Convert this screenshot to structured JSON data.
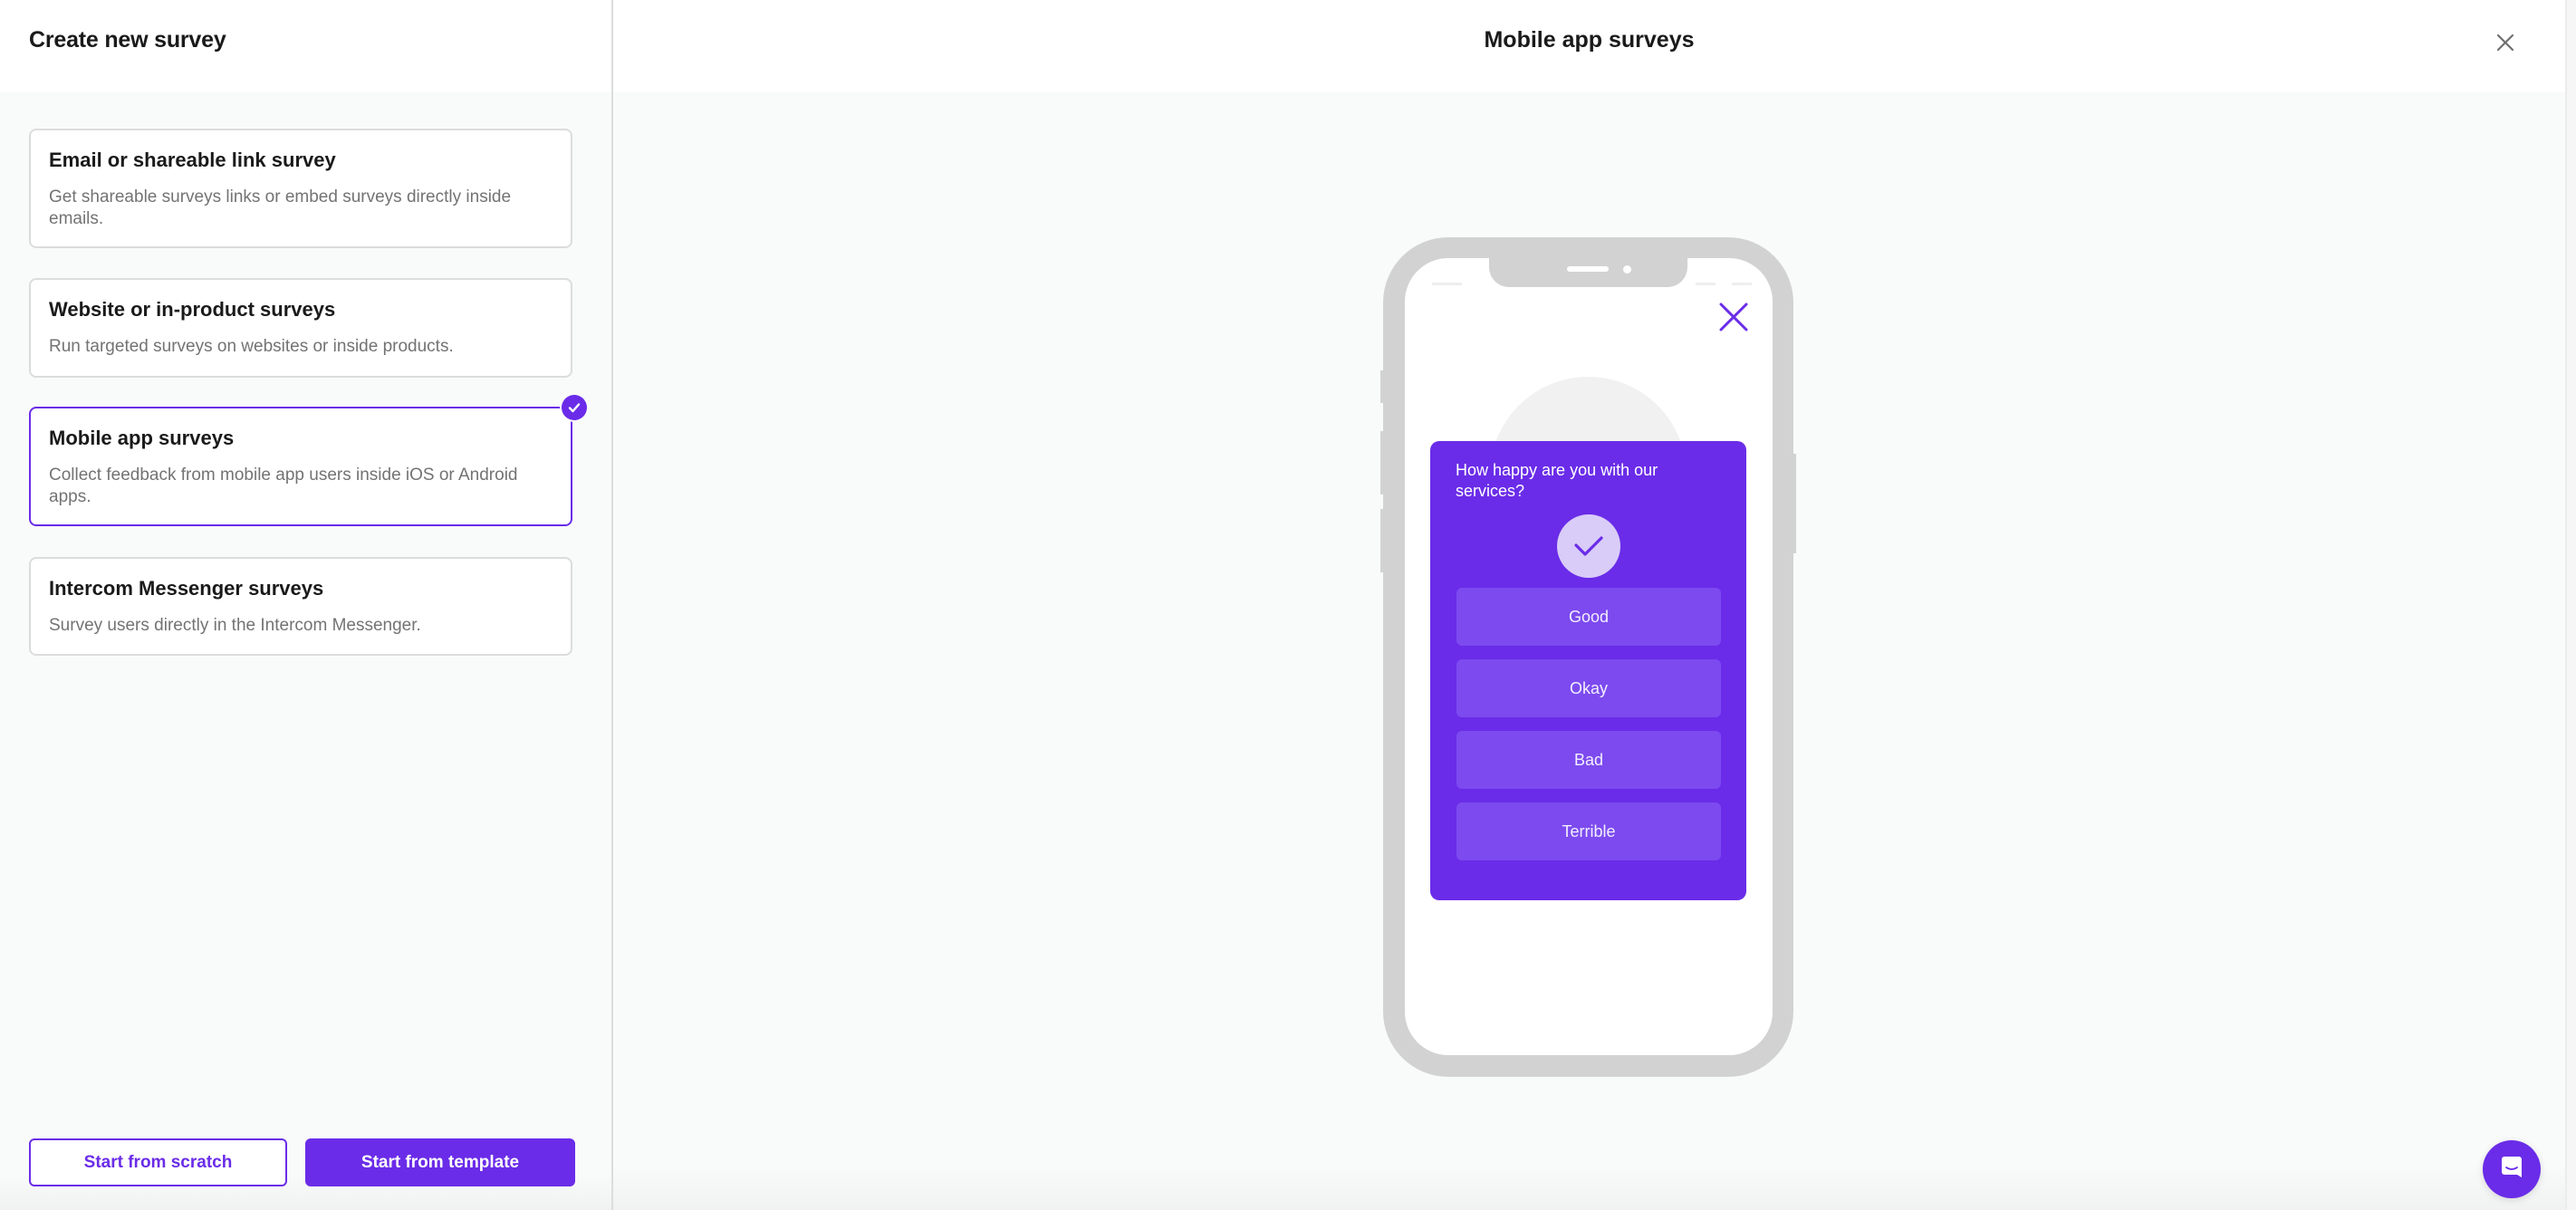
{
  "sidebar": {
    "title": "Create new survey",
    "options": [
      {
        "title": "Email or shareable link survey",
        "description": "Get shareable surveys links or embed surveys directly inside emails.",
        "selected": false
      },
      {
        "title": "Website or in-product surveys",
        "description": "Run targeted surveys on websites or inside products.",
        "selected": false
      },
      {
        "title": "Mobile app surveys",
        "description": "Collect feedback from mobile app users inside iOS or Android apps.",
        "selected": true
      },
      {
        "title": "Intercom Messenger surveys",
        "description": "Survey users directly in the Intercom Messenger.",
        "selected": false
      }
    ],
    "buttons": {
      "scratch": "Start from scratch",
      "template": "Start from template"
    }
  },
  "preview": {
    "title": "Mobile app surveys",
    "close_icon": "close-icon",
    "survey": {
      "question": "How happy are you with our services?",
      "icon": "checkmark-icon",
      "answers": [
        "Good",
        "Okay",
        "Bad",
        "Terrible"
      ]
    }
  },
  "launcher": {
    "icon": "messenger-icon"
  },
  "colors": {
    "accent": "#6a2ce8",
    "answer_bg": "#7c4aef",
    "check_circle_bg": "#d9ccf8",
    "phone_frame": "#d2d2d2",
    "border": "#dcdcdc",
    "muted_text": "#737373"
  }
}
